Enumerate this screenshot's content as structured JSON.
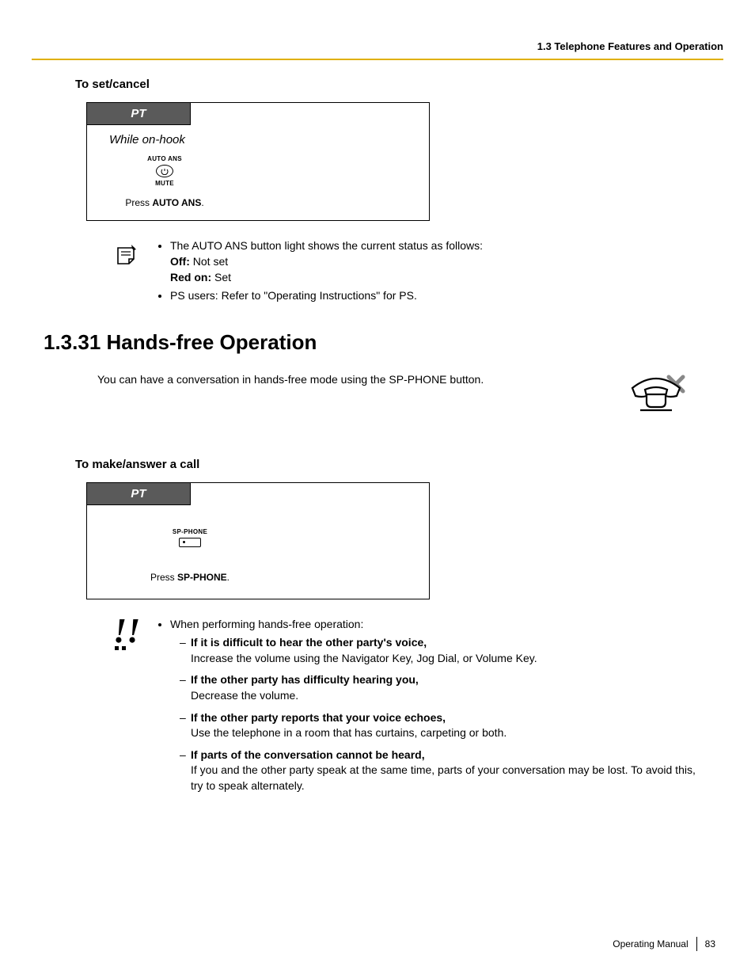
{
  "header": "1.3 Telephone Features and Operation",
  "sec1": {
    "heading": "To set/cancel",
    "tab": "PT",
    "state": "While on-hook",
    "btn_top": "AUTO ANS",
    "btn_bottom": "MUTE",
    "press_prefix": "Press ",
    "press_bold": "AUTO ANS",
    "press_suffix": "."
  },
  "notes": {
    "n1": "The AUTO ANS button light shows the current status as follows:",
    "off_label": "Off:",
    "off_text": " Not set",
    "red_label": "Red on:",
    "red_text": " Set",
    "n2": "PS users: Refer to \"Operating Instructions\" for PS."
  },
  "title": "1.3.31  Hands-free Operation",
  "intro": "You can have a conversation in hands-free mode using the SP-PHONE button.",
  "sec2": {
    "heading": "To make/answer a call",
    "tab": "PT",
    "btn_label": "SP-PHONE",
    "press_prefix": "Press ",
    "press_bold": "SP-PHONE",
    "press_suffix": "."
  },
  "tips": {
    "lead": "When performing hands-free operation:",
    "items": [
      {
        "bold": "If it is difficult to hear the other party's voice,",
        "body": "Increase the volume using the Navigator Key, Jog Dial, or Volume Key."
      },
      {
        "bold": "If the other party has difficulty hearing you,",
        "body": "Decrease the volume."
      },
      {
        "bold": "If the other party reports that your voice echoes,",
        "body": "Use the telephone in a room that has curtains, carpeting or both."
      },
      {
        "bold": "If parts of the conversation cannot be heard,",
        "body": "If you and the other party speak at the same time, parts of your conversation may be lost. To avoid this, try to speak alternately."
      }
    ]
  },
  "footer": {
    "manual": "Operating Manual",
    "page": "83"
  }
}
